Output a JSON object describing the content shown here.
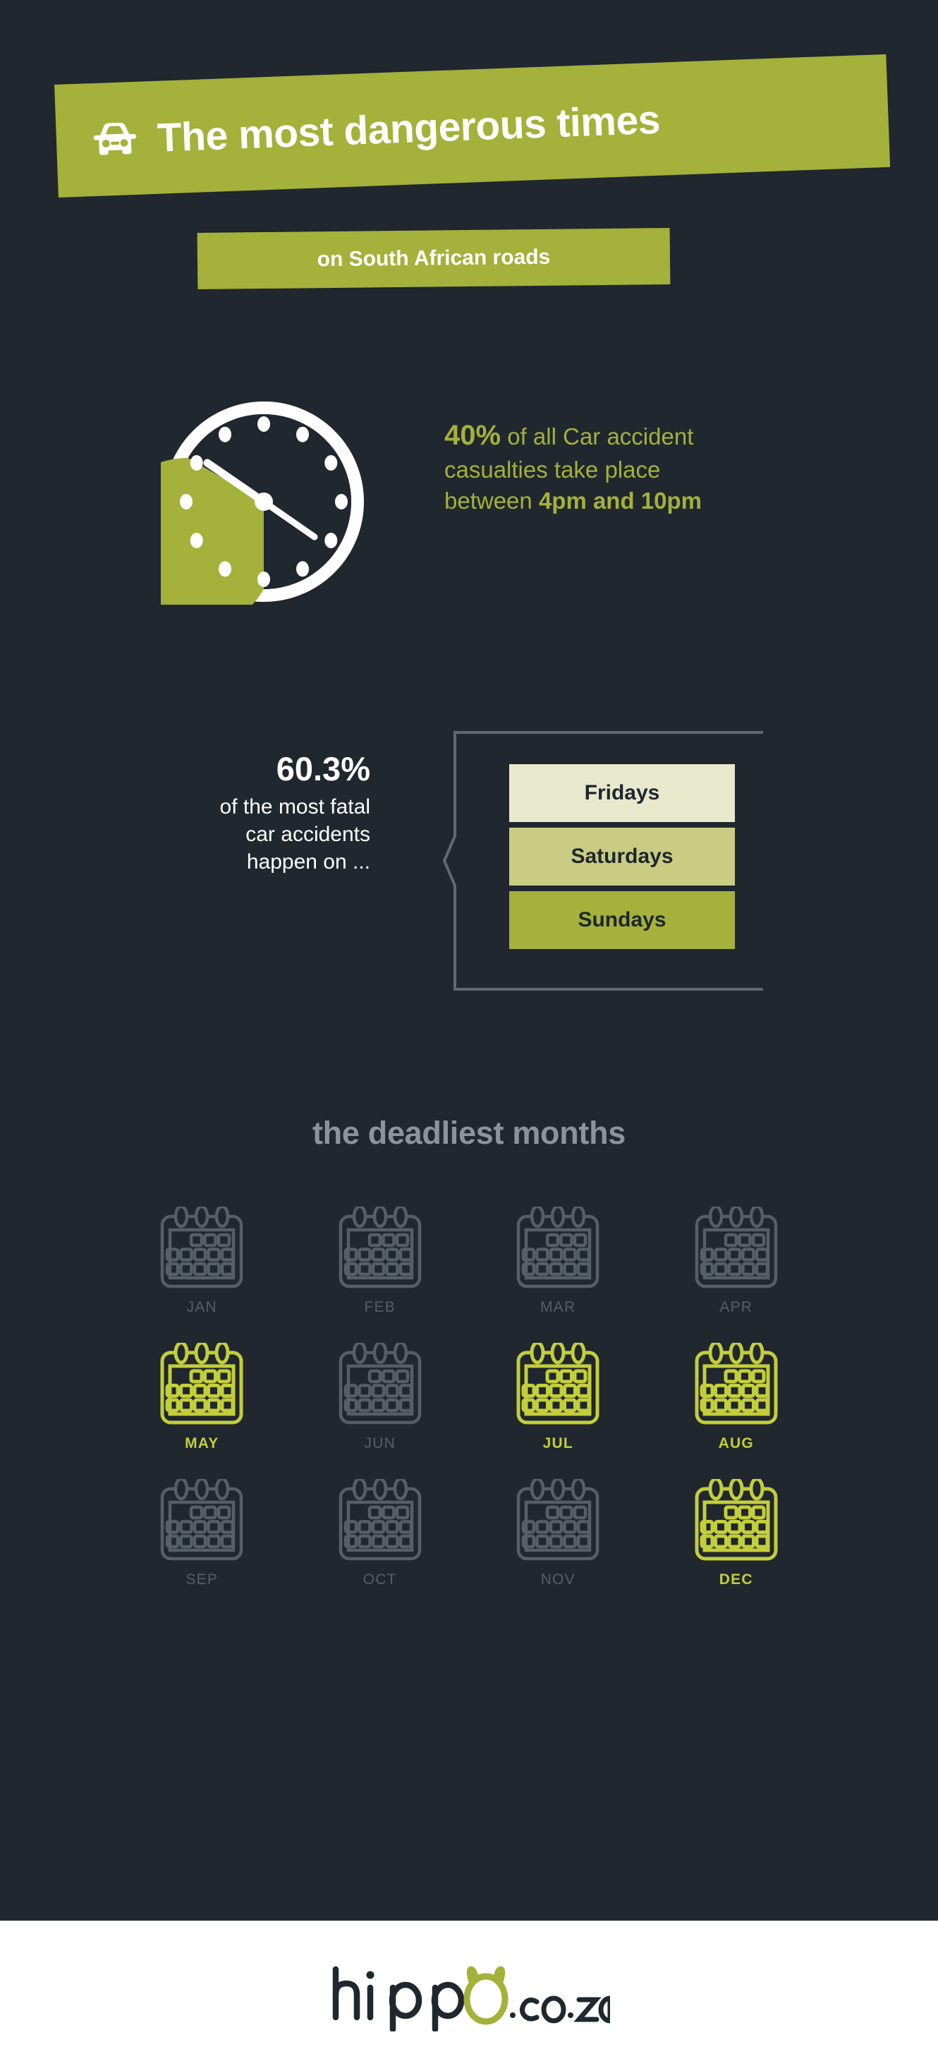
{
  "theme": {
    "background": "#20272F",
    "green": "#A4B13A",
    "green_bright": "#C3CE3A",
    "dim_grey": "#565E68",
    "heading_grey": "#8B939B",
    "white": "#FFFFFF",
    "footer_background": "#FFFFFF"
  },
  "header": {
    "icon": "car-icon",
    "title": "The most dangerous times",
    "subtitle": "on South African roads"
  },
  "clock_stat": {
    "icon": "clock-icon",
    "percent": "40%",
    "text_middle": " of all Car accident casualties take place between ",
    "line1_rest": "of all Car accident",
    "line2": "casualties take place",
    "line3_prefix": "between ",
    "time_range": "4pm and 10pm",
    "range_start_hour": 16,
    "range_end_hour": 22
  },
  "days_stat": {
    "percent": "60.3%",
    "description": "of the most fatal car accidents happen on ...",
    "description_lines": [
      "of the most fatal",
      "car accidents",
      "happen on ..."
    ],
    "bars": [
      {
        "label": "Fridays",
        "color": "#E7E8CC"
      },
      {
        "label": "Saturdays",
        "color": "#C9CC82"
      },
      {
        "label": "Sundays",
        "color": "#A5B13A"
      }
    ]
  },
  "months_section": {
    "title": "the deadliest months",
    "months": [
      {
        "label": "JAN",
        "highlighted": false
      },
      {
        "label": "FEB",
        "highlighted": false
      },
      {
        "label": "MAR",
        "highlighted": false
      },
      {
        "label": "APR",
        "highlighted": false
      },
      {
        "label": "MAY",
        "highlighted": true
      },
      {
        "label": "JUN",
        "highlighted": false
      },
      {
        "label": "JUL",
        "highlighted": true
      },
      {
        "label": "AUG",
        "highlighted": true
      },
      {
        "label": "SEP",
        "highlighted": false
      },
      {
        "label": "OCT",
        "highlighted": false
      },
      {
        "label": "NOV",
        "highlighted": false
      },
      {
        "label": "DEC",
        "highlighted": true
      }
    ]
  },
  "footer": {
    "logo_name": "hippo.co.za",
    "logo_part1": "hipp",
    "logo_part2": ".co.za"
  }
}
